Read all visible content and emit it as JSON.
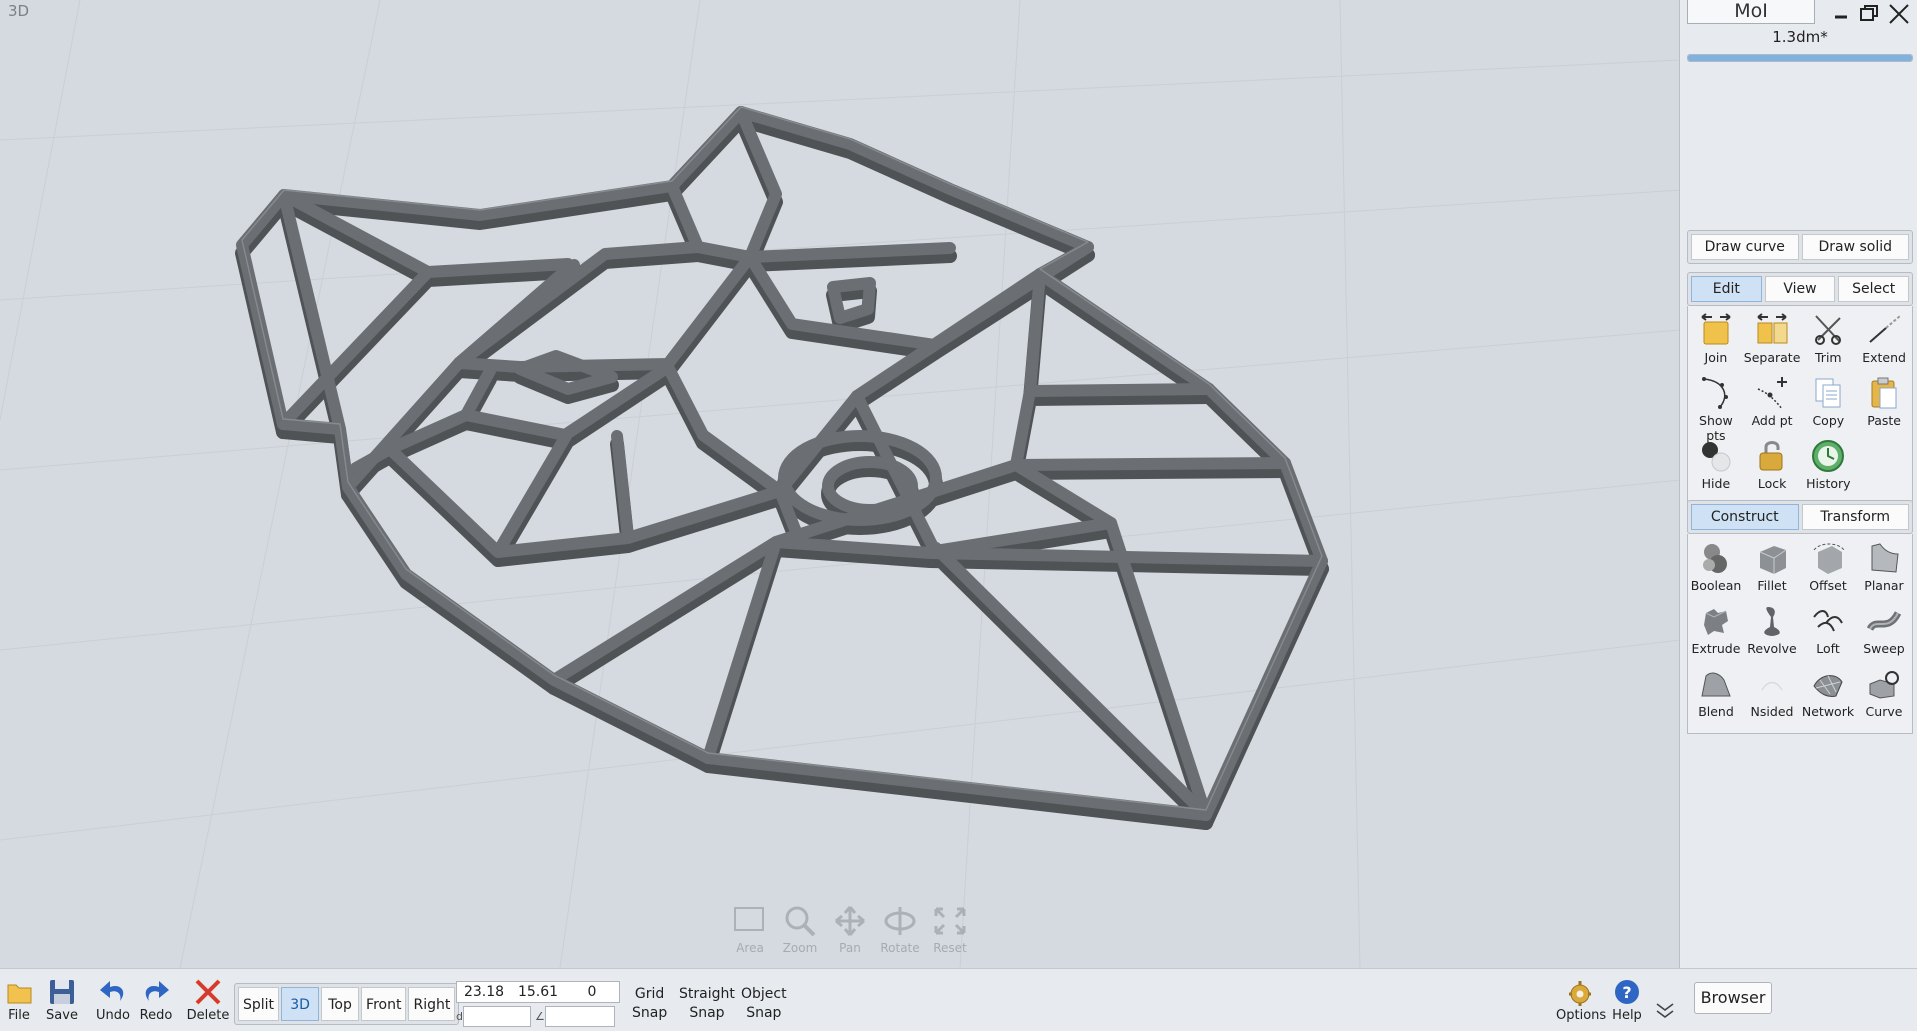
{
  "viewport": {
    "label": "3D",
    "nav_tools": [
      "Area",
      "Zoom",
      "Pan",
      "Rotate",
      "Reset"
    ]
  },
  "panel": {
    "title": "MoI",
    "file_size": "1.3dm*",
    "progress": 1.0,
    "draw_tabs": [
      "Draw curve",
      "Draw solid"
    ],
    "edit_tabs": [
      "Edit",
      "View",
      "Select"
    ],
    "edit_active": "Edit",
    "edit_tools": [
      {
        "label": "Join",
        "icon": "join-icon"
      },
      {
        "label": "Separate",
        "icon": "separate-icon"
      },
      {
        "label": "Trim",
        "icon": "trim-icon"
      },
      {
        "label": "Extend",
        "icon": "extend-icon"
      },
      {
        "label": "Show pts",
        "icon": "show-points-icon"
      },
      {
        "label": "Add pt",
        "icon": "add-point-icon"
      },
      {
        "label": "Copy",
        "icon": "copy-icon"
      },
      {
        "label": "Paste",
        "icon": "paste-icon"
      },
      {
        "label": "Hide",
        "icon": "hide-icon"
      },
      {
        "label": "Lock",
        "icon": "lock-icon"
      },
      {
        "label": "History",
        "icon": "history-icon"
      }
    ],
    "construct_tabs": [
      "Construct",
      "Transform"
    ],
    "construct_active": "Construct",
    "construct_tools": [
      {
        "label": "Boolean",
        "icon": "boolean-icon"
      },
      {
        "label": "Fillet",
        "icon": "fillet-icon"
      },
      {
        "label": "Offset",
        "icon": "offset-icon"
      },
      {
        "label": "Planar",
        "icon": "planar-icon"
      },
      {
        "label": "Extrude",
        "icon": "extrude-icon"
      },
      {
        "label": "Revolve",
        "icon": "revolve-icon"
      },
      {
        "label": "Loft",
        "icon": "loft-icon"
      },
      {
        "label": "Sweep",
        "icon": "sweep-icon"
      },
      {
        "label": "Blend",
        "icon": "blend-icon"
      },
      {
        "label": "Nsided",
        "icon": "nsided-icon"
      },
      {
        "label": "Network",
        "icon": "network-icon"
      },
      {
        "label": "Curve",
        "icon": "curve-icon"
      }
    ]
  },
  "bottom": {
    "file": "File",
    "save": "Save",
    "undo": "Undo",
    "redo": "Redo",
    "delete": "Delete",
    "views": [
      "Split",
      "3D",
      "Top",
      "Front",
      "Right"
    ],
    "view_active": "3D",
    "coords": [
      "23.18",
      "15.61",
      "0"
    ],
    "distance_prefix": "d",
    "angle_prefix": "∠",
    "distance_value": "",
    "angle_value": "",
    "grid_snap": [
      "Grid",
      "Snap"
    ],
    "straight_snap": [
      "Straight",
      "Snap"
    ],
    "object_snap": [
      "Object",
      "Snap"
    ],
    "options": "Options",
    "help": "Help",
    "browser": "Browser"
  },
  "colors": {
    "viewport_bg": "#d4dadf",
    "model_top": "#6b6f73",
    "model_side": "#55595c",
    "active_tab": "#cfe1f4"
  }
}
